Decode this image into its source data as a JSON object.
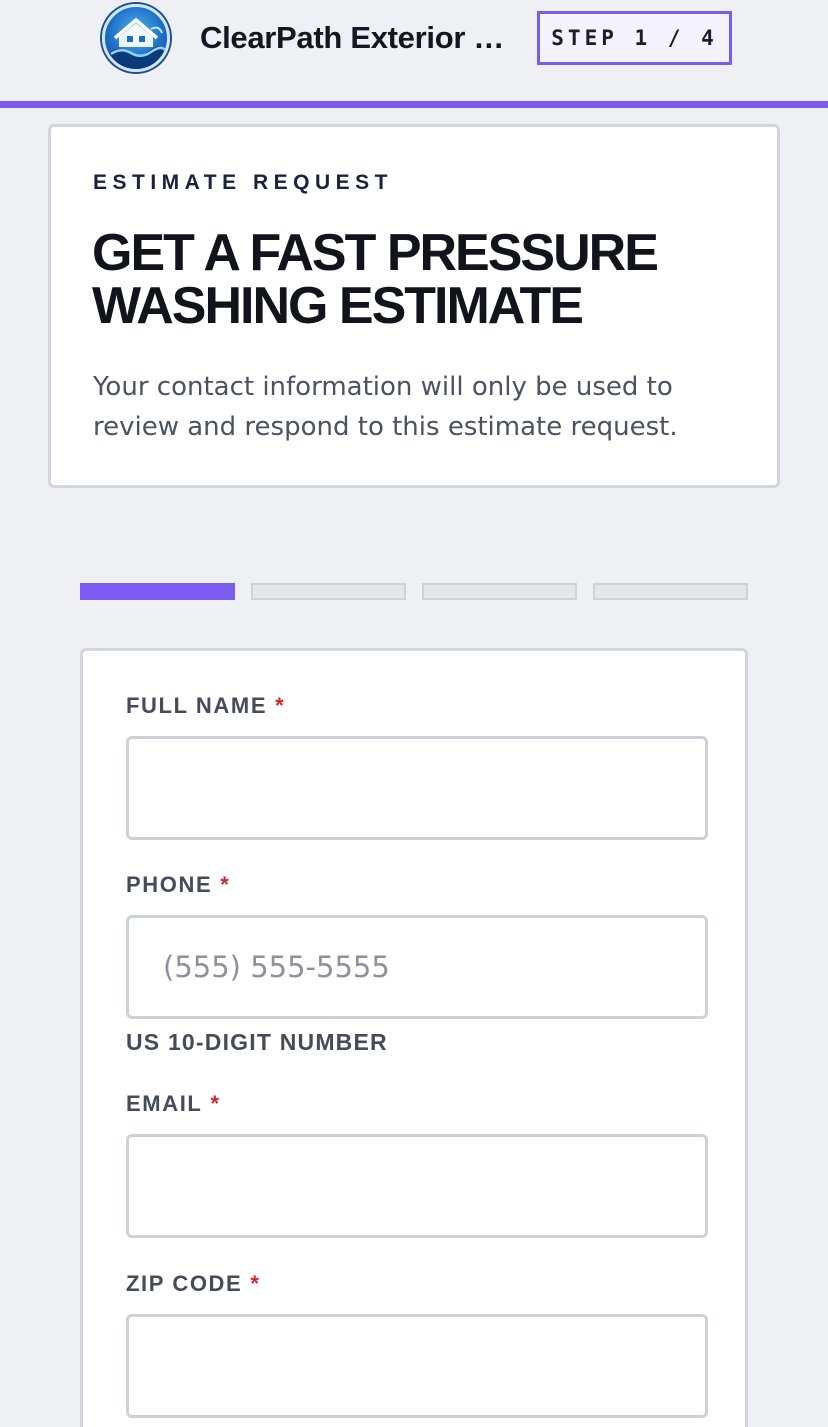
{
  "header": {
    "brand_name": "ClearPath Exterior Pressure Washing",
    "step_label": "STEP 1 / 4",
    "logo_icon": "house-wave-logo-icon",
    "accent_color": "#7a5cf0"
  },
  "intro": {
    "eyebrow": "ESTIMATE REQUEST",
    "title": "GET A FAST PRESSURE WASHING ESTIMATE",
    "subtitle": "Your contact information will only be used to review and respond to this estimate request."
  },
  "progress": {
    "current_step": 1,
    "total_steps": 4
  },
  "form": {
    "full_name": {
      "label": "FULL NAME",
      "required_mark": "*",
      "value": "",
      "placeholder": ""
    },
    "phone": {
      "label": "PHONE",
      "required_mark": "*",
      "value": "",
      "placeholder": "(555) 555-5555",
      "hint": "US 10-DIGIT NUMBER"
    },
    "email": {
      "label": "EMAIL",
      "required_mark": "*",
      "value": "",
      "placeholder": ""
    },
    "zip": {
      "label": "ZIP CODE",
      "required_mark": "*",
      "value": "",
      "placeholder": ""
    }
  }
}
